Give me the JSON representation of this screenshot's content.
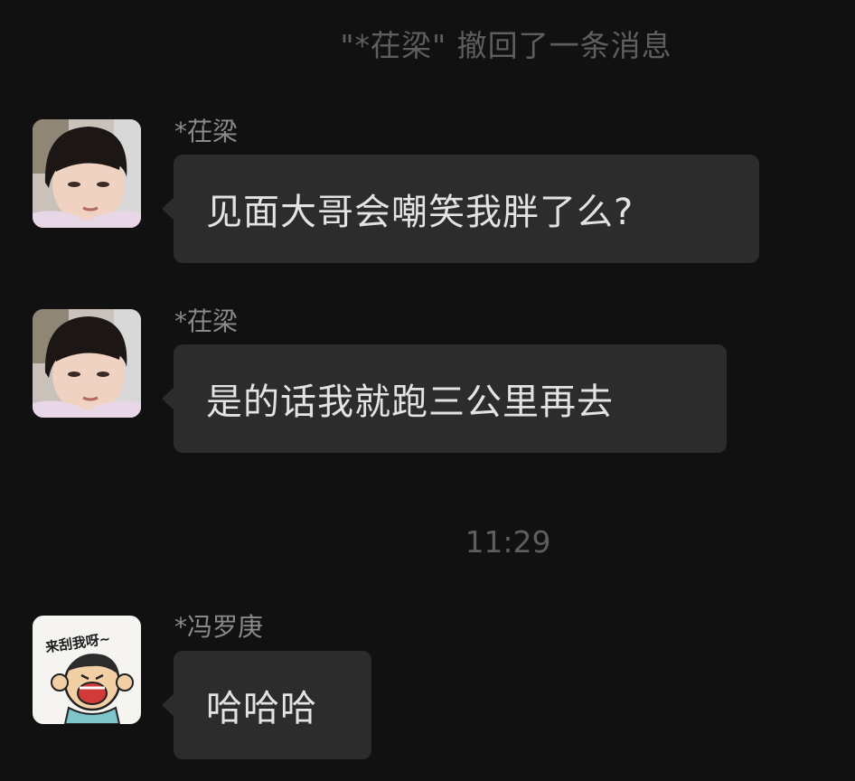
{
  "system_notice": "\"*茌梁\" 撤回了一条消息",
  "timestamp": "11:29",
  "messages": [
    {
      "sender": "*茌梁",
      "text": "见面大哥会嘲笑我胖了么?",
      "avatar": "girl-photo"
    },
    {
      "sender": "*茌梁",
      "text": "是的话我就跑三公里再去",
      "avatar": "girl-photo"
    },
    {
      "sender": "*冯罗庚",
      "text": "哈哈哈",
      "avatar": "cartoon-sticker",
      "avatar_caption": "来刮我呀~"
    }
  ]
}
